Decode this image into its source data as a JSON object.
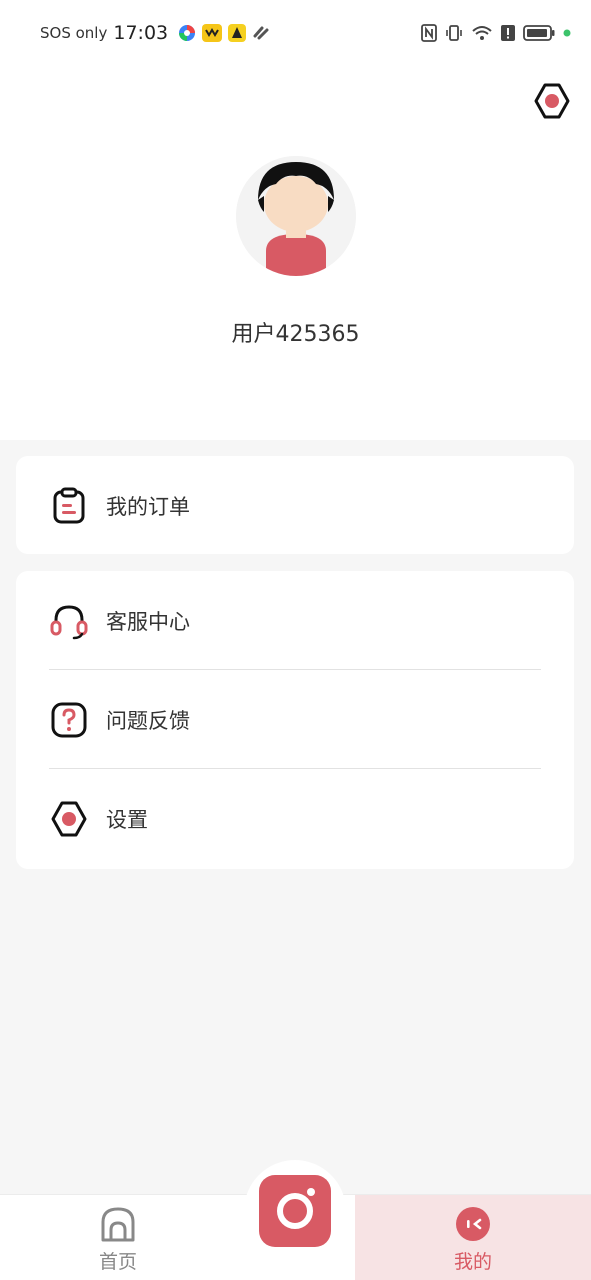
{
  "status_bar": {
    "carrier": "SOS only",
    "time": "17:03"
  },
  "profile": {
    "username": "用户425365"
  },
  "menu": {
    "orders": "我的订单",
    "customer_service": "客服中心",
    "feedback": "问题反馈",
    "settings": "设置"
  },
  "tabbar": {
    "home": "首页",
    "mine": "我的"
  },
  "colors": {
    "accent": "#d85a64",
    "tab_active_bg": "#f7e3e4",
    "page_bg": "#f6f6f6"
  },
  "icons": {
    "settings": "gear-icon",
    "orders": "clipboard-icon",
    "customer_service": "headset-icon",
    "feedback": "question-icon",
    "home": "home-icon",
    "mine": "user-face-icon",
    "camera": "camera-icon"
  }
}
